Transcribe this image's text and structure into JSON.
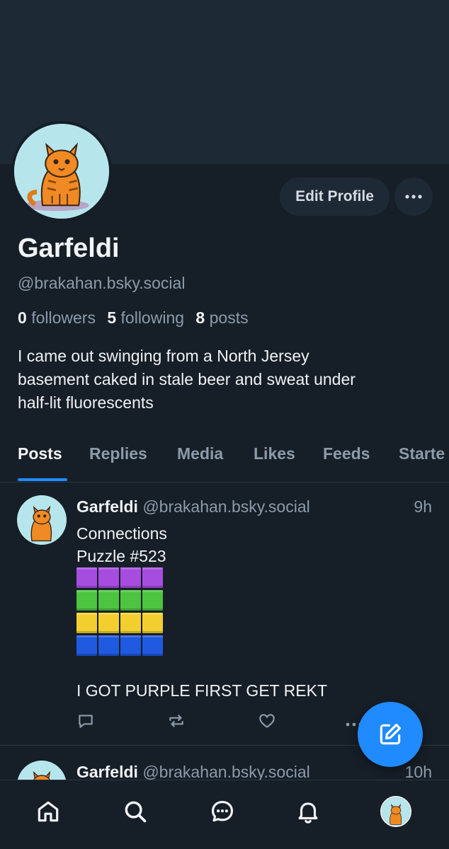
{
  "profile": {
    "display_name": "Garfeldi",
    "handle": "@brakahan.bsky.social",
    "followers_count": "0",
    "followers_label": "followers",
    "following_count": "5",
    "following_label": "following",
    "posts_count": "8",
    "posts_label": "posts",
    "bio_lines": [
      "I came out swinging from a North Jersey",
      "basement caked in stale beer and sweat under",
      "half-lit fluorescents"
    ],
    "edit_button_label": "Edit Profile"
  },
  "tabs": [
    {
      "label": "Posts",
      "active": true
    },
    {
      "label": "Replies",
      "active": false
    },
    {
      "label": "Media",
      "active": false
    },
    {
      "label": "Likes",
      "active": false
    },
    {
      "label": "Feeds",
      "active": false
    },
    {
      "label": "Starte",
      "active": false
    }
  ],
  "posts": [
    {
      "author": "Garfeldi",
      "handle": "@brakahan.bsky.social",
      "time": "9h",
      "text_line1": "Connections",
      "text_line2": "Puzzle #523",
      "emoji_grid": [
        [
          "purple",
          "purple",
          "purple",
          "purple"
        ],
        [
          "green",
          "green",
          "green",
          "green"
        ],
        [
          "yellow",
          "yellow",
          "yellow",
          "yellow"
        ],
        [
          "blue",
          "blue",
          "blue",
          "blue"
        ]
      ],
      "text_after": "I GOT PURPLE FIRST GET REKT"
    },
    {
      "author": "Garfeldi",
      "handle": "@brakahan.bsky.social",
      "time": "10h"
    }
  ],
  "icons": {
    "more": "ellipsis-icon",
    "reply": "reply-icon",
    "repost": "repost-icon",
    "like": "heart-icon",
    "compose": "compose-icon",
    "home": "home-icon",
    "search": "search-icon",
    "chat": "chat-icon",
    "notifications": "bell-icon"
  },
  "colors": {
    "background": "#161e27",
    "banner": "#1e2936",
    "accent": "#208bfe",
    "muted_text": "#8c9bab",
    "purple": "#a64de0",
    "green": "#4cc43f",
    "yellow": "#f2cf2f",
    "blue": "#1f5ae0"
  }
}
